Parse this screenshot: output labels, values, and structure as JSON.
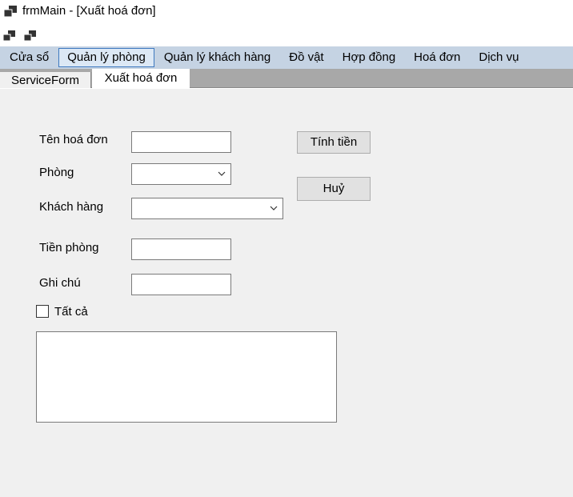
{
  "window": {
    "title": "frmMain - [Xuất hoá đơn]"
  },
  "menu": {
    "items": [
      {
        "label": "Cửa sổ"
      },
      {
        "label": "Quản lý phòng"
      },
      {
        "label": "Quản lý khách hàng"
      },
      {
        "label": "Đồ vật"
      },
      {
        "label": "Hợp đồng"
      },
      {
        "label": "Hoá đơn"
      },
      {
        "label": "Dịch vụ"
      }
    ],
    "active_index": 1
  },
  "tabs": [
    {
      "label": "ServiceForm",
      "selected": false
    },
    {
      "label": "Xuất hoá đơn",
      "selected": true
    }
  ],
  "form": {
    "invoice_name": {
      "label": "Tên hoá đơn",
      "value": ""
    },
    "room": {
      "label": "Phòng",
      "value": ""
    },
    "customer": {
      "label": "Khách hàng",
      "value": ""
    },
    "room_fee": {
      "label": "Tiền phòng",
      "value": ""
    },
    "note": {
      "label": "Ghi chú",
      "value": ""
    },
    "all_checkbox": {
      "label": "Tất cả",
      "checked": false
    },
    "calc_button": "Tính tiền",
    "cancel_button": "Huỷ"
  },
  "colors": {
    "menubar": "#c5d3e3",
    "form_bg": "#f0f0f0",
    "active_menu_border": "#3e79c0"
  }
}
